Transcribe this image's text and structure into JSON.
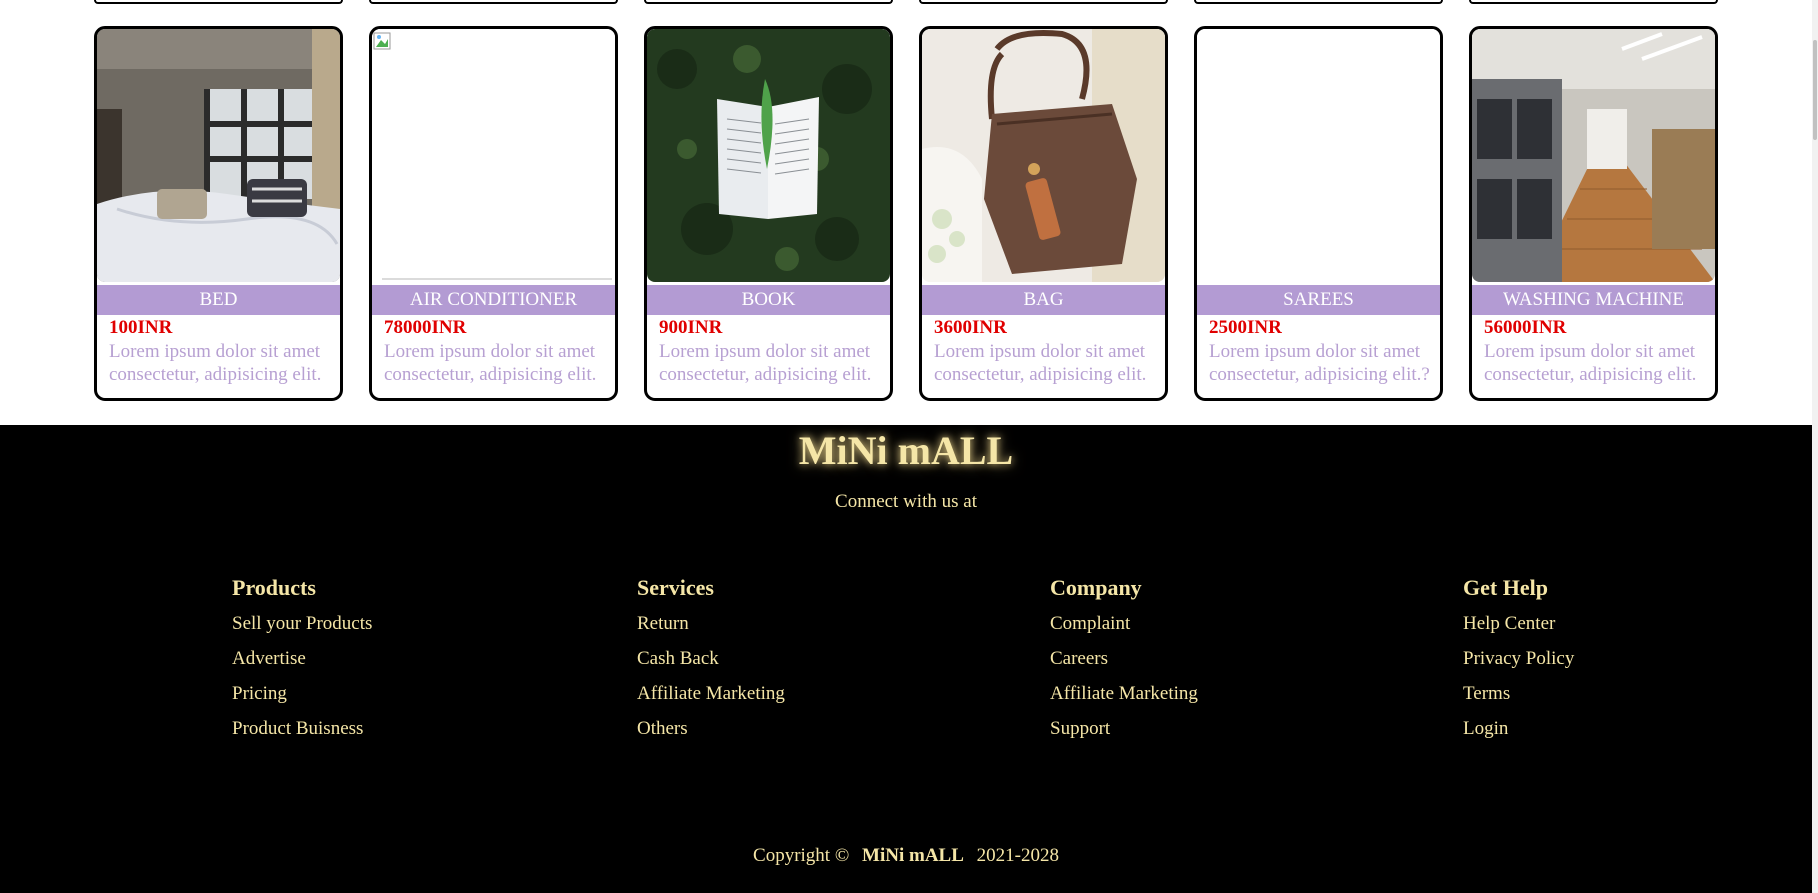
{
  "products": [
    {
      "name": "BED",
      "price": "100INR",
      "desc": "Lorem ipsum dolor sit amet consectetur, adipisicing elit."
    },
    {
      "name": "AIR CONDITIONER",
      "price": "78000INR",
      "desc": "Lorem ipsum dolor sit amet consectetur, adipisicing elit."
    },
    {
      "name": "BOOK",
      "price": "900INR",
      "desc": "Lorem ipsum dolor sit amet consectetur, adipisicing elit."
    },
    {
      "name": "BAG",
      "price": "3600INR",
      "desc": "Lorem ipsum dolor sit amet consectetur, adipisicing elit."
    },
    {
      "name": "SAREES",
      "price": "2500INR",
      "desc": "Lorem ipsum dolor sit amet consectetur, adipisicing elit.?"
    },
    {
      "name": "WASHING MACHINE",
      "price": "56000INR",
      "desc": "Lorem ipsum dolor sit amet consectetur, adipisicing elit."
    }
  ],
  "footer": {
    "brand": "MiNi mALL",
    "connect": "Connect with us at",
    "columns": [
      {
        "title": "Products",
        "items": [
          "Sell your Products",
          "Advertise",
          "Pricing",
          "Product Buisness"
        ]
      },
      {
        "title": "Services",
        "items": [
          "Return",
          "Cash Back",
          "Affiliate Marketing",
          "Others"
        ]
      },
      {
        "title": "Company",
        "items": [
          "Complaint",
          "Careers",
          "Affiliate Marketing",
          "Support"
        ]
      },
      {
        "title": "Get Help",
        "items": [
          "Help Center",
          "Privacy Policy",
          "Terms",
          "Login"
        ]
      }
    ],
    "copyright_prefix": "Copyright ©",
    "copyright_brand": "MiNi mALL",
    "copyright_years": "2021-2028"
  },
  "colors": {
    "title_bar": "#b39bd3",
    "price": "#e00000",
    "desc": "#b7a0d2",
    "footer_text": "#f5e6a7"
  }
}
